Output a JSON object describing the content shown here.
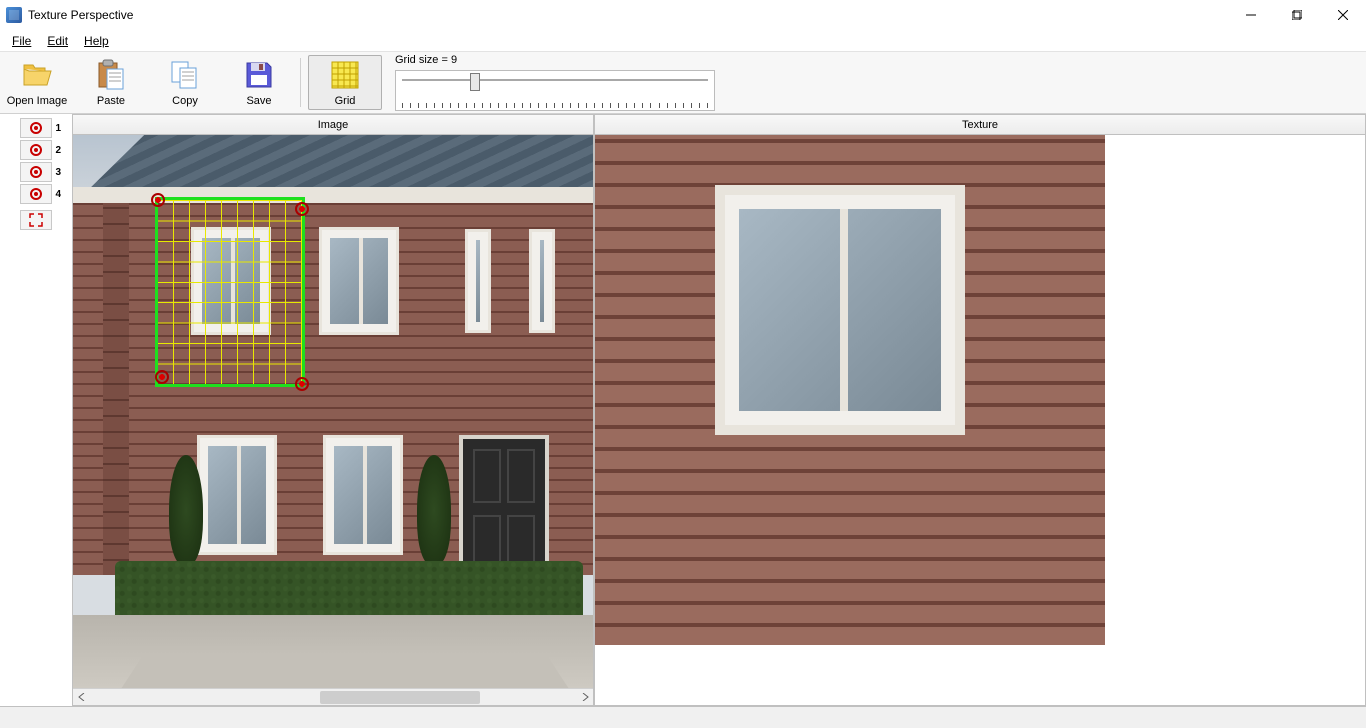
{
  "window": {
    "title": "Texture Perspective"
  },
  "menu": {
    "file": "File",
    "edit": "Edit",
    "help": "Help"
  },
  "toolbar": {
    "open_image": "Open Image",
    "paste": "Paste",
    "copy": "Copy",
    "save": "Save",
    "grid": "Grid"
  },
  "slider": {
    "label_prefix": "Grid size  = ",
    "value": "9"
  },
  "side": {
    "points": [
      "1",
      "2",
      "3",
      "4"
    ]
  },
  "panels": {
    "image": "Image",
    "texture": "Texture"
  }
}
